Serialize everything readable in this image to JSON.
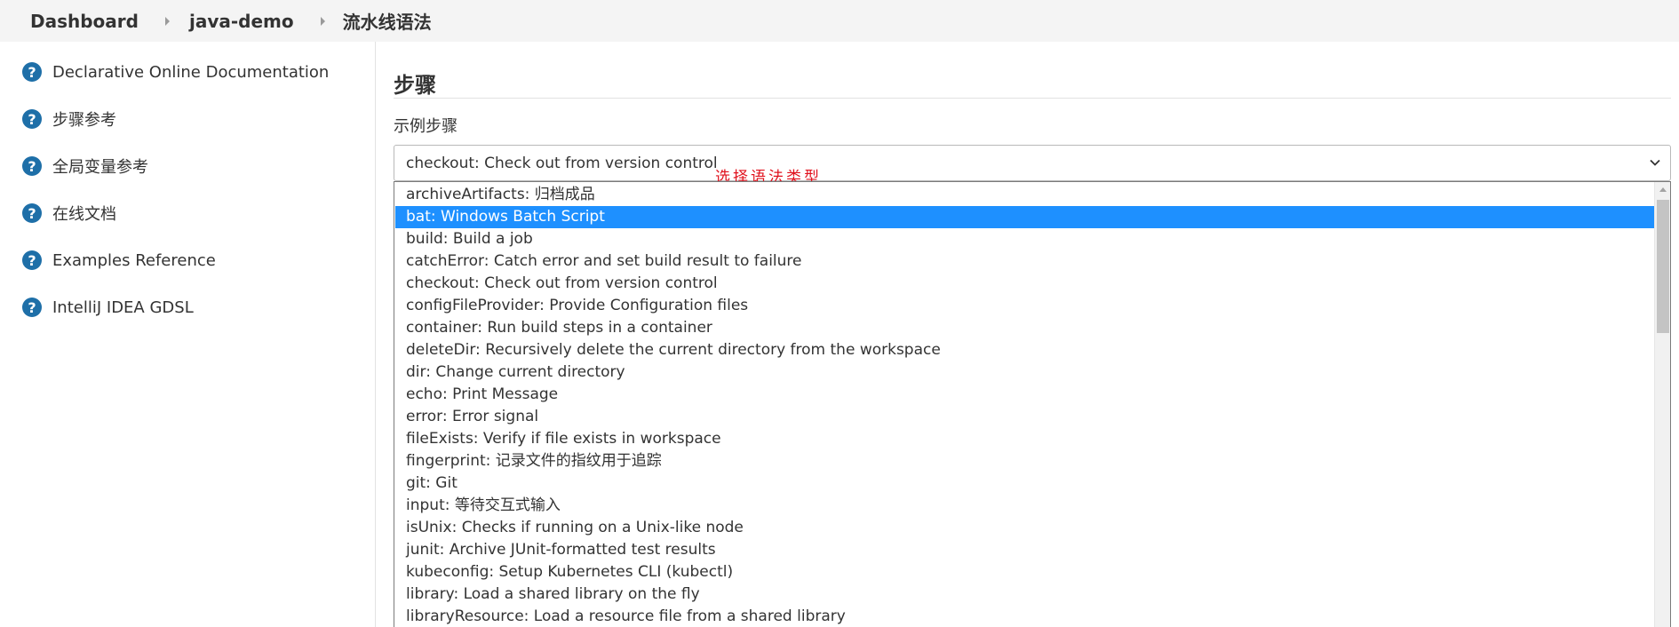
{
  "breadcrumb": {
    "items": [
      "Dashboard",
      "java-demo",
      "流水线语法"
    ]
  },
  "sidebar": {
    "items": [
      {
        "label": "Declarative Online Documentation",
        "icon": "help-icon"
      },
      {
        "label": "步骤参考",
        "icon": "help-icon"
      },
      {
        "label": "全局变量参考",
        "icon": "help-icon"
      },
      {
        "label": "在线文档",
        "icon": "help-icon"
      },
      {
        "label": "Examples Reference",
        "icon": "help-icon"
      },
      {
        "label": "IntelliJ IDEA GDSL",
        "icon": "help-icon"
      }
    ]
  },
  "main": {
    "section_title": "步骤",
    "field_label": "示例步骤",
    "select_value": "checkout: Check out from version control",
    "annotation": "选择语法类型",
    "options": [
      "archiveArtifacts: 归档成品",
      "bat: Windows Batch Script",
      "build: Build a job",
      "catchError: Catch error and set build result to failure",
      "checkout: Check out from version control",
      "configFileProvider: Provide Configuration files",
      "container: Run build steps in a container",
      "deleteDir: Recursively delete the current directory from the workspace",
      "dir: Change current directory",
      "echo: Print Message",
      "error: Error signal",
      "fileExists: Verify if file exists in workspace",
      "fingerprint: 记录文件的指纹用于追踪",
      "git: Git",
      "input: 等待交互式输入",
      "isUnix: Checks if running on a Unix-like node",
      "junit: Archive JUnit-formatted test results",
      "kubeconfig: Setup Kubernetes CLI (kubectl)",
      "library: Load a shared library on the fly",
      "libraryResource: Load a resource file from a shared library"
    ],
    "highlighted_option": "bat: Windows Batch Script"
  },
  "colors": {
    "accent": "#1e90ff",
    "help_icon": "#1e6fa8",
    "annotation": "#e0101c"
  }
}
